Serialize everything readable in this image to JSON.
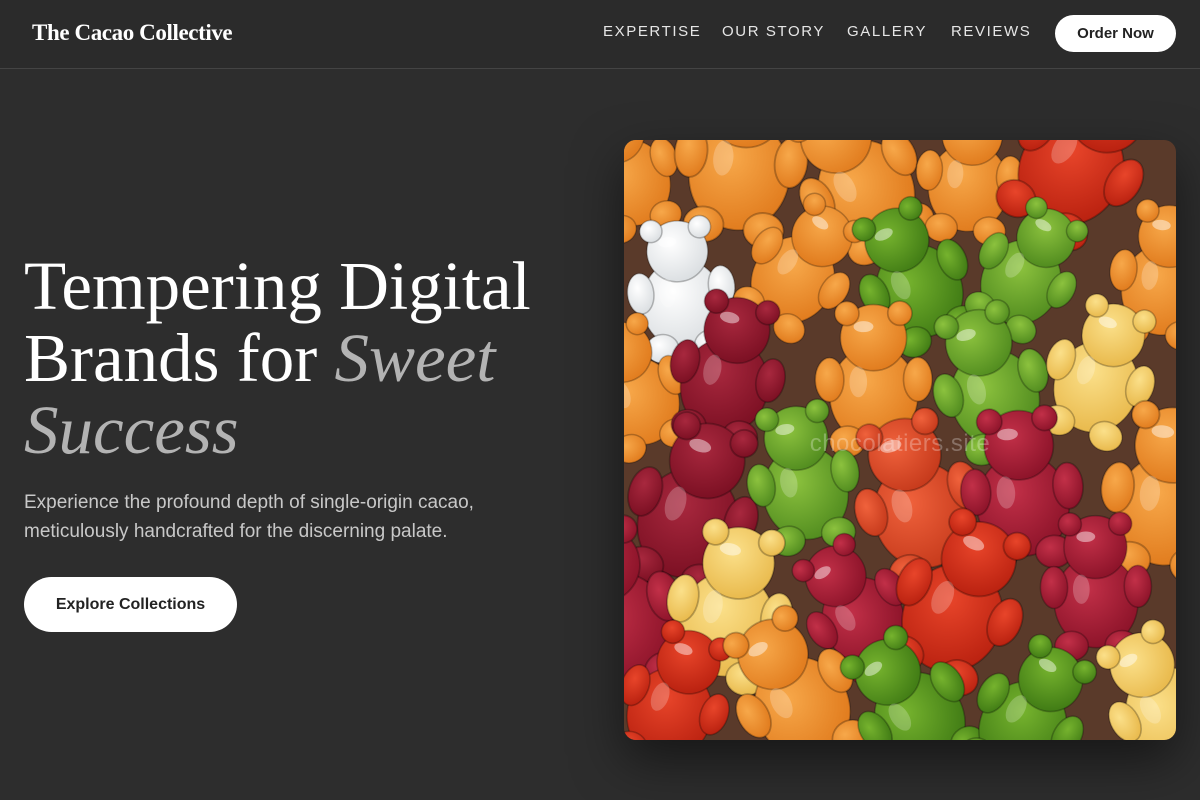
{
  "header": {
    "logo": "The Cacao Collective",
    "nav": {
      "expertise": "EXPERTISE",
      "story": "OUR STORY",
      "gallery": "GALLERY",
      "reviews": "REVIEWS"
    },
    "cta": "Order Now"
  },
  "hero": {
    "headline_main": "Tempering Digital Brands for ",
    "headline_accent": "Sweet Success",
    "subtext": "Experience the profound depth of single-origin cacao, meticulously handcrafted for the discerning palate.",
    "button": "Explore Collections"
  },
  "image": {
    "subject": "assorted gummy bears",
    "watermark": "chocolatiers.site"
  },
  "colors": {
    "background": "#2d2d2d",
    "accent_text": "#b3b3b3",
    "button_bg": "#ffffff",
    "button_text": "#222222"
  }
}
